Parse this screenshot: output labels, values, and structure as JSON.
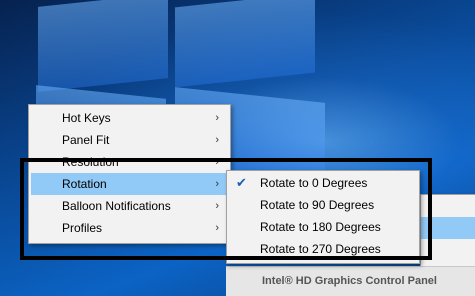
{
  "main_menu": {
    "items": [
      {
        "label": "Hot Keys",
        "has_submenu": true,
        "highlighted": false
      },
      {
        "label": "Panel Fit",
        "has_submenu": true,
        "highlighted": false
      },
      {
        "label": "Resolution",
        "has_submenu": true,
        "highlighted": false
      },
      {
        "label": "Rotation",
        "has_submenu": true,
        "highlighted": true
      },
      {
        "label": "Balloon Notifications",
        "has_submenu": true,
        "highlighted": false
      },
      {
        "label": "Profiles",
        "has_submenu": true,
        "highlighted": false
      }
    ],
    "submenu_arrow_glyph": "›"
  },
  "rotation_submenu": {
    "items": [
      {
        "label": "Rotate to 0 Degrees",
        "checked": true
      },
      {
        "label": "Rotate to 90 Degrees",
        "checked": false
      },
      {
        "label": "Rotate to 180 Degrees",
        "checked": false
      },
      {
        "label": "Rotate to 270 Degrees",
        "checked": false
      }
    ],
    "check_glyph": "✔"
  },
  "tray_menu_footer": {
    "label": "Intel® HD Graphics Control Panel"
  },
  "colors": {
    "highlight": "#91c9f7",
    "menu_background": "#f2f2f2",
    "annotation_frame": "#000000"
  }
}
